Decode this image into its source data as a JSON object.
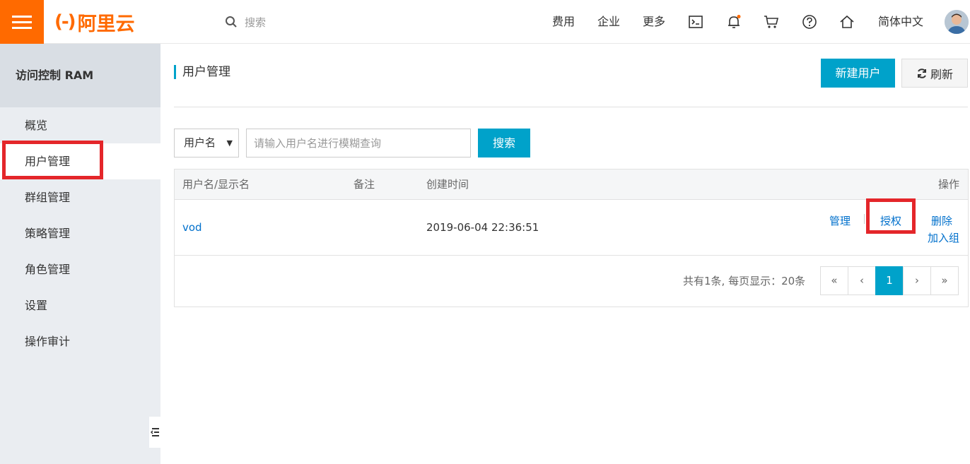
{
  "header": {
    "logo_mark": "(-)",
    "logo_text": "阿里云",
    "search_placeholder": "搜索",
    "nav": [
      "费用",
      "企业",
      "更多"
    ],
    "language": "简体中文",
    "icons": [
      "menu-icon",
      "search-icon",
      "terminal-icon",
      "bell-icon",
      "cart-icon",
      "help-icon",
      "home-icon",
      "avatar"
    ]
  },
  "sidebar": {
    "title": "访问控制 RAM",
    "items": [
      {
        "label": "概览"
      },
      {
        "label": "用户管理",
        "active": true
      },
      {
        "label": "群组管理"
      },
      {
        "label": "策略管理"
      },
      {
        "label": "角色管理"
      },
      {
        "label": "设置"
      },
      {
        "label": "操作审计"
      }
    ]
  },
  "main": {
    "title": "用户管理",
    "new_user_label": "新建用户",
    "refresh_label": "刷新",
    "filter": {
      "select_value": "用户名",
      "input_placeholder": "请输入用户名进行模糊查询",
      "search_label": "搜索"
    },
    "table": {
      "columns": [
        "用户名/显示名",
        "备注",
        "创建时间",
        "操作"
      ],
      "rows": [
        {
          "username": "vod",
          "note": "",
          "created": "2019-06-04 22:36:51",
          "actions": [
            "管理",
            "授权",
            "删除",
            "加入组"
          ]
        }
      ]
    },
    "pagination": {
      "summary": "共有1条, 每页显示：20条",
      "first": "«",
      "prev": "‹",
      "current": "1",
      "next": "›",
      "last": "»"
    }
  },
  "colors": {
    "brand": "#ff6a00",
    "primary": "#00a2ca",
    "link": "#0070cc",
    "highlight": "#e4262a"
  }
}
